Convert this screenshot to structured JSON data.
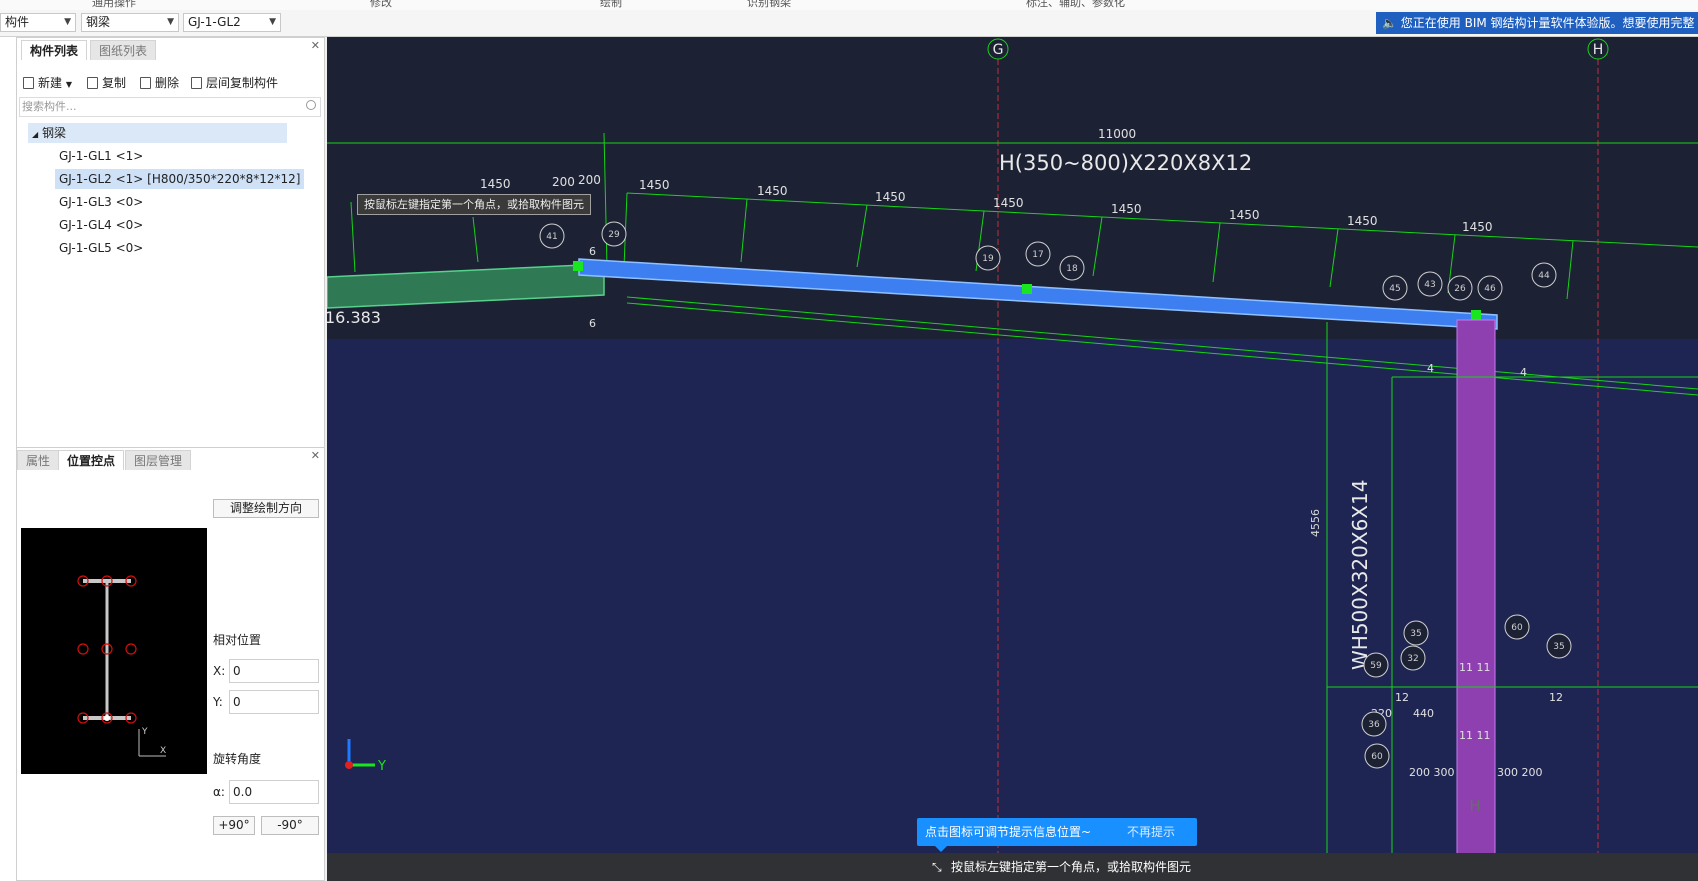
{
  "menu": {
    "items": [
      "通用操作",
      "修改",
      "绘制",
      "识别钢梁",
      "标注、辅助、参数化"
    ]
  },
  "toolbar": {
    "combo1": "构件",
    "combo2": "钢梁",
    "combo3": "GJ-1-GL2"
  },
  "notice": {
    "text": "您正在使用 BIM 钢结构计量软件体验版。想要使用完整"
  },
  "component_panel": {
    "tabs": [
      "构件列表",
      "图纸列表"
    ],
    "actions": {
      "new": "新建",
      "copy": "复制",
      "delete": "删除",
      "floor_copy": "层间复制构件"
    },
    "search_placeholder": "搜索构件...",
    "tree_root": "钢梁",
    "items": [
      "GJ-1-GL1 <1>",
      "GJ-1-GL2 <1> [H800/350*220*8*12*12]",
      "GJ-1-GL3 <0>",
      "GJ-1-GL4 <0>",
      "GJ-1-GL5 <0>"
    ]
  },
  "property_panel": {
    "tabs": [
      "属性",
      "位置控点",
      "图层管理"
    ],
    "adjust_direction": "调整绘制方向",
    "relative_position": "相对位置",
    "x_label": "X:",
    "x_value": "0",
    "y_label": "Y:",
    "y_value": "0",
    "rotation_label": "旋转角度",
    "alpha_label": "α:",
    "alpha_value": "0.0",
    "plus90": "+90°",
    "minus90": "-90°",
    "preview_axis_y": "Y",
    "preview_axis_x": "X"
  },
  "canvas": {
    "axis_g": "G",
    "axis_h": "H",
    "axis_h_bottom": "H",
    "total_dim": "11000",
    "beam_section": "H(350~800)X220X8X12",
    "column_section": "WH500X320X6X14",
    "column_height_dim": "4556",
    "elevation": "16.383",
    "segment_dims": [
      "1450",
      "200",
      "200",
      "1450",
      "1450",
      "1450",
      "1450",
      "1450",
      "1450",
      "1450",
      "1450"
    ],
    "bubbles": [
      "41",
      "29",
      "19",
      "17",
      "18",
      "45",
      "43",
      "26",
      "46",
      "44",
      "35",
      "60",
      "59",
      "32",
      "36",
      "35",
      "60"
    ],
    "small_labels": [
      "6",
      "6",
      "4",
      "4",
      "12",
      "12",
      "11 11",
      "11 11",
      "220",
      "440",
      "200 300",
      "300 200"
    ],
    "ucs_y": "Y",
    "tooltip": "按鼠标左键指定第一个角点，或拾取构件图元"
  },
  "info_bubble": {
    "message": "点击图标可调节提示信息位置~",
    "dismiss": "不再提示"
  },
  "status_bar": {
    "text": "按鼠标左键指定第一个角点，或拾取构件图元"
  },
  "colors": {
    "canvas_bg": "#1c2134",
    "beam_blue": "#3d7ff0",
    "beam_green": "#3fae6a",
    "column_purple": "#8e3fb0",
    "dim_green": "#17d417",
    "notice_blue": "#1f5fbf"
  }
}
